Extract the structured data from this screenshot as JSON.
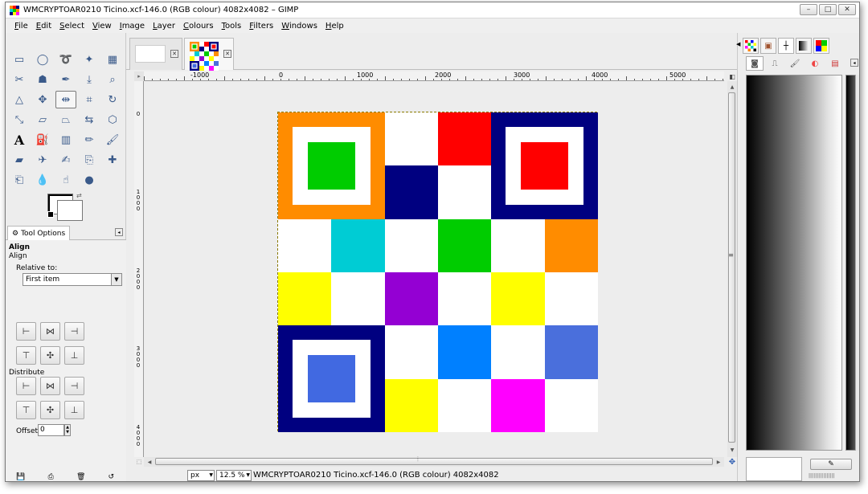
{
  "window": {
    "title": "WMCRYPTOAR0210 Ticino.xcf-146.0 (RGB colour) 4082x4082 – GIMP",
    "minimize_glyph": "–",
    "maximize_glyph": "□",
    "close_glyph": "✕"
  },
  "menubar": {
    "items": [
      "File",
      "Edit",
      "Select",
      "View",
      "Image",
      "Layer",
      "Colours",
      "Tools",
      "Filters",
      "Windows",
      "Help"
    ]
  },
  "toolbox": {
    "text_tool_glyph": "A",
    "tool_options_tab": "Tool Options",
    "heading": "Align",
    "subheading": "Align",
    "relative_to_label": "Relative to:",
    "relative_to_value": "First item",
    "distribute_label": "Distribute",
    "offset_label": "Offset:",
    "offset_value": "0"
  },
  "rulers": {
    "horizontal": [
      "-1000",
      "0",
      "1000",
      "2000",
      "3000",
      "4000",
      "5000"
    ],
    "vertical": [
      "0",
      "1000",
      "2000",
      "3000",
      "4000"
    ]
  },
  "statusbar": {
    "unit": "px",
    "zoom": "12.5 %",
    "text": "WMCRYPTOAR0210 Ticino.xcf-146.0 (RGB colour) 4082x4082"
  },
  "colors": {
    "orange": "#ff8c00",
    "green": "#00cc00",
    "red": "#ff0000",
    "navy": "#000080",
    "cyan": "#00ccd4",
    "yellow": "#ffff00",
    "purple": "#9400d3",
    "azure": "#0080ff",
    "cornflower": "#4a6fdc",
    "royal": "#4169e1",
    "magenta": "#ff00ff",
    "white": "#ffffff"
  }
}
